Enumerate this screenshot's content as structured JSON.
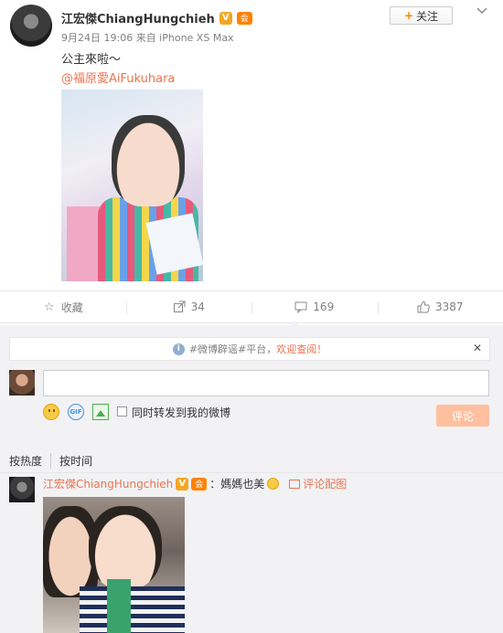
{
  "post": {
    "author": "江宏傑ChiangHungchieh",
    "verified_badge": "V",
    "member_badge": "会",
    "follow_label": "关注",
    "meta": "9月24日 19:06 来自 iPhone XS Max",
    "text": "公主來啦～",
    "mention": "@福原愛AiFukuhara"
  },
  "actions": [
    {
      "icon": "star-icon",
      "label": "收藏"
    },
    {
      "icon": "share-icon",
      "label": "34"
    },
    {
      "icon": "comment-icon",
      "label": "169"
    },
    {
      "icon": "like-icon",
      "label": "3387"
    }
  ],
  "notice": {
    "prefix": "#微博辟谣#平台，",
    "link": "欢迎查阅！",
    "close": "✕"
  },
  "composer": {
    "share_label": "同时转发到我的微博",
    "submit_label": "评论",
    "gif_label": "GIF"
  },
  "sort": {
    "by_heat": "按热度",
    "by_time": "按时间"
  },
  "comment": {
    "author": "江宏傑ChiangHungchieh",
    "verified_badge": "V",
    "member_badge": "会",
    "text": "：媽媽也美",
    "pic_link": "评论配图"
  },
  "colors": {
    "link": "#eb7350",
    "accent": "#ff8200",
    "comment_bg": "#f2f2f5",
    "submit_disabled": "#ffc09f"
  }
}
